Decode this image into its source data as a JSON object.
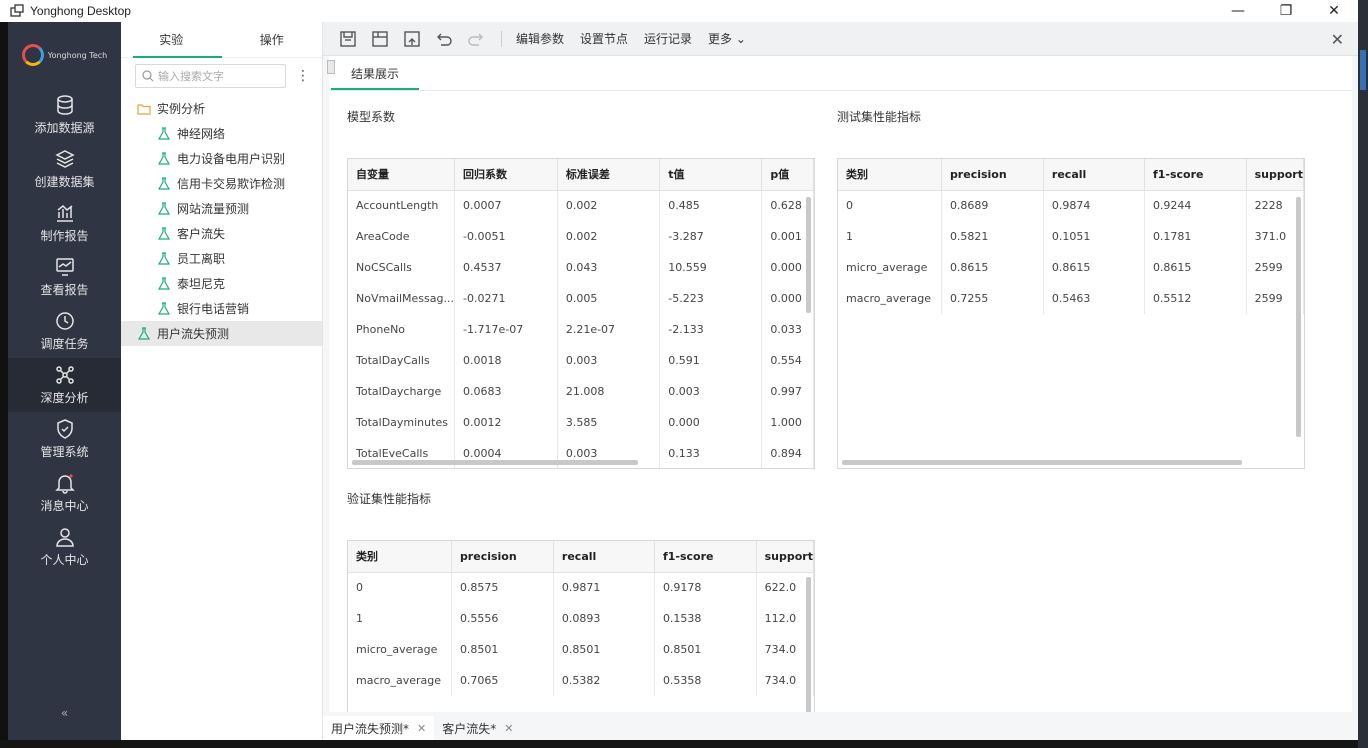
{
  "window": {
    "title": "Yonghong Desktop",
    "minimize": "—",
    "maximize": "❐",
    "close": "✕"
  },
  "nav": {
    "logo_text": "Yonghong Tech",
    "items": [
      {
        "label": "添加数据源",
        "icon": "database-icon"
      },
      {
        "label": "创建数据集",
        "icon": "layers-icon"
      },
      {
        "label": "制作报告",
        "icon": "chart-icon"
      },
      {
        "label": "查看报告",
        "icon": "monitor-icon"
      },
      {
        "label": "调度任务",
        "icon": "clock-icon"
      },
      {
        "label": "深度分析",
        "icon": "network-icon"
      },
      {
        "label": "管理系统",
        "icon": "shield-icon"
      },
      {
        "label": "消息中心",
        "icon": "bell-icon"
      },
      {
        "label": "个人中心",
        "icon": "user-icon"
      }
    ],
    "collapse": "«"
  },
  "tree_panel": {
    "tabs": [
      "实验",
      "操作"
    ],
    "search_placeholder": "输入搜索文字",
    "more": "⋮",
    "folder": "实例分析",
    "children": [
      "神经网络",
      "电力设备电用户识别",
      "信用卡交易欺诈检测",
      "网站流量预测",
      "客户流失",
      "员工离职",
      "泰坦尼克",
      "银行电话营销"
    ],
    "selected": "用户流失预测"
  },
  "toolbar": {
    "buttons": [
      "编辑参数",
      "设置节点",
      "运行记录",
      "更多 ⌄"
    ],
    "close": "✕"
  },
  "content": {
    "tab": "结果展示",
    "coef_title": "模型系数",
    "coef_headers": [
      "自变量",
      "回归系数",
      "标准误差",
      "t值",
      "p值"
    ],
    "coef_rows": [
      [
        "AccountLength",
        "0.0007",
        "0.002",
        "0.485",
        "0.628"
      ],
      [
        "AreaCode",
        "-0.0051",
        "0.002",
        "-3.287",
        "0.001"
      ],
      [
        "NoCSCalls",
        "0.4537",
        "0.043",
        "10.559",
        "0.000"
      ],
      [
        "NoVmailMessag...",
        "-0.0271",
        "0.005",
        "-5.223",
        "0.000"
      ],
      [
        "PhoneNo",
        "-1.717e-07",
        "2.21e-07",
        "-2.133",
        "0.033"
      ],
      [
        "TotalDayCalls",
        "0.0018",
        "0.003",
        "0.591",
        "0.554"
      ],
      [
        "TotalDaycharge",
        "0.0683",
        "21.008",
        "0.003",
        "0.997"
      ],
      [
        "TotalDayminutes",
        "0.0012",
        "3.585",
        "0.000",
        "1.000"
      ],
      [
        "TotalEveCalls",
        "0.0004",
        "0.003",
        "0.133",
        "0.894"
      ]
    ],
    "test_title": "测试集性能指标",
    "metric_headers": [
      "类别",
      "precision",
      "recall",
      "f1-score",
      "support"
    ],
    "test_rows": [
      [
        "0",
        "0.8689",
        "0.9874",
        "0.9244",
        "2228"
      ],
      [
        "1",
        "0.5821",
        "0.1051",
        "0.1781",
        "371.0"
      ],
      [
        "micro_average",
        "0.8615",
        "0.8615",
        "0.8615",
        "2599"
      ],
      [
        "macro_average",
        "0.7255",
        "0.5463",
        "0.5512",
        "2599"
      ]
    ],
    "val_title": "验证集性能指标",
    "val_rows": [
      [
        "0",
        "0.8575",
        "0.9871",
        "0.9178",
        "622.0"
      ],
      [
        "1",
        "0.5556",
        "0.0893",
        "0.1538",
        "112.0"
      ],
      [
        "micro_average",
        "0.8501",
        "0.8501",
        "0.8501",
        "734.0"
      ],
      [
        "macro_average",
        "0.7065",
        "0.5382",
        "0.5358",
        "734.0"
      ]
    ]
  },
  "bottom_tabs": [
    "用户流失预测*",
    "客户流失*"
  ],
  "colors": {
    "accent": "#1aad7c",
    "nav_bg": "#2f3542"
  }
}
